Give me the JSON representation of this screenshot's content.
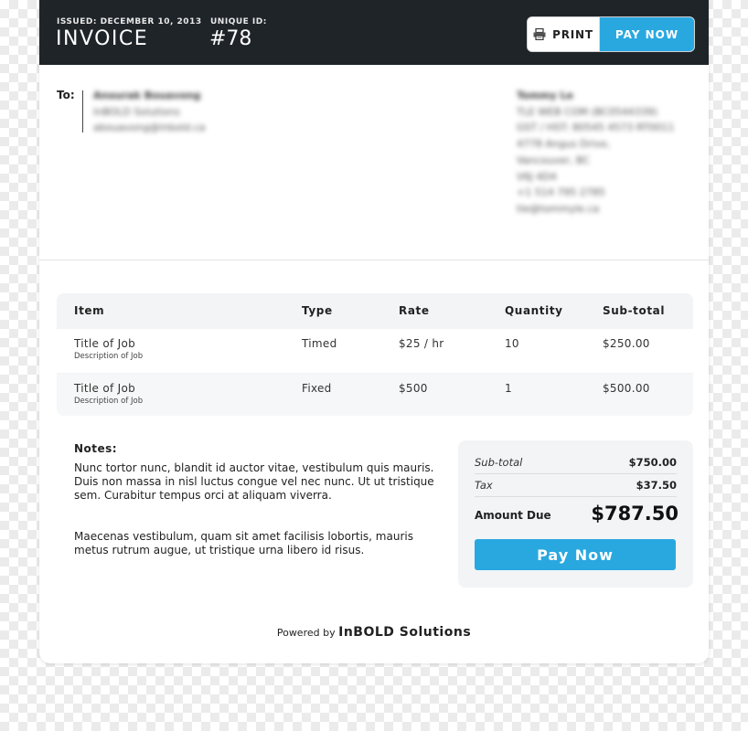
{
  "header": {
    "issued_label": "ISSUED: DECEMBER 10, 2013",
    "unique_id_label": "UNIQUE ID:",
    "title": "INVOICE",
    "invoice_id": "#78",
    "print_label": "PRINT",
    "pay_now_label": "PAY NOW"
  },
  "recipient": {
    "to_label": "To:",
    "lines": [
      "Anourak Bouavong",
      "InBOLD Solutions",
      "abouavong@inbold.ca"
    ]
  },
  "sender": {
    "lines": [
      "Tommy Le",
      "TLE WEB COM (BC0544339)",
      "GST / HST: 80545 4573 RT0011",
      "4778 Angus Drive,",
      "Vancouver, BC",
      "V6J 4D4",
      "+1 514 795 2785",
      "tle@tommyle.ca"
    ]
  },
  "table": {
    "headers": [
      "Item",
      "Type",
      "Rate",
      "Quantity",
      "Sub-total"
    ],
    "rows": [
      {
        "item": "Title of Job",
        "description": "Description of Job",
        "type": "Timed",
        "rate": "$25 / hr",
        "quantity": "10",
        "subtotal": "$250.00"
      },
      {
        "item": "Title of Job",
        "description": "Description of Job",
        "type": "Fixed",
        "rate": "$500",
        "quantity": "1",
        "subtotal": "$500.00"
      }
    ]
  },
  "notes": {
    "title": "Notes:",
    "paragraph1": "Nunc tortor nunc, blandit id auctor vitae, vestibulum quis mauris. Duis non massa in nisl luctus congue vel nec nunc. Ut ut tristique sem. Curabitur tempus orci at aliquam viverra.",
    "paragraph2": "Maecenas vestibulum, quam sit amet facilisis lobortis, mauris metus rutrum augue, ut tristique urna libero id risus."
  },
  "summary": {
    "subtotal_label": "Sub-total",
    "subtotal_value": "$750.00",
    "tax_label": "Tax",
    "tax_value": "$37.50",
    "amount_due_label": "Amount Due",
    "amount_due_value": "$787.50",
    "pay_now_label": "Pay Now"
  },
  "footer": {
    "powered_by": "Powered by",
    "brand": "InBOLD Solutions"
  },
  "colors": {
    "header_bg": "#1f2429",
    "accent": "#29a8e0"
  },
  "icons": {
    "print": "printer-icon"
  }
}
